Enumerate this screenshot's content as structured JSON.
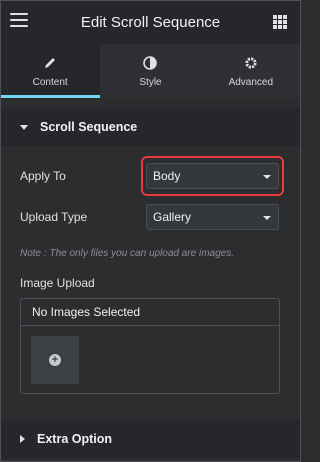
{
  "header": {
    "title": "Edit Scroll Sequence",
    "menu_icon": "hamburger-icon",
    "grid_icon": "apps-grid-icon"
  },
  "tabs": [
    {
      "label": "Content",
      "icon": "pencil-icon",
      "active": true
    },
    {
      "label": "Style",
      "icon": "half-circle-icon",
      "active": false
    },
    {
      "label": "Advanced",
      "icon": "gear-icon",
      "active": false
    }
  ],
  "section": {
    "title": "Scroll Sequence",
    "expanded": true
  },
  "apply_to": {
    "label": "Apply To",
    "value": "Body"
  },
  "upload_type": {
    "label": "Upload Type",
    "value": "Gallery"
  },
  "note": "Note : The only files you can upload are images.",
  "image_upload": {
    "label": "Image Upload",
    "status": "No Images Selected",
    "add_icon": "plus-circle-icon"
  },
  "extra": {
    "title": "Extra Option",
    "expanded": false
  },
  "colors": {
    "accent": "#71d7f7",
    "highlight": "#e83a3f",
    "panel": "#2c2d2f",
    "header": "#26272a"
  }
}
